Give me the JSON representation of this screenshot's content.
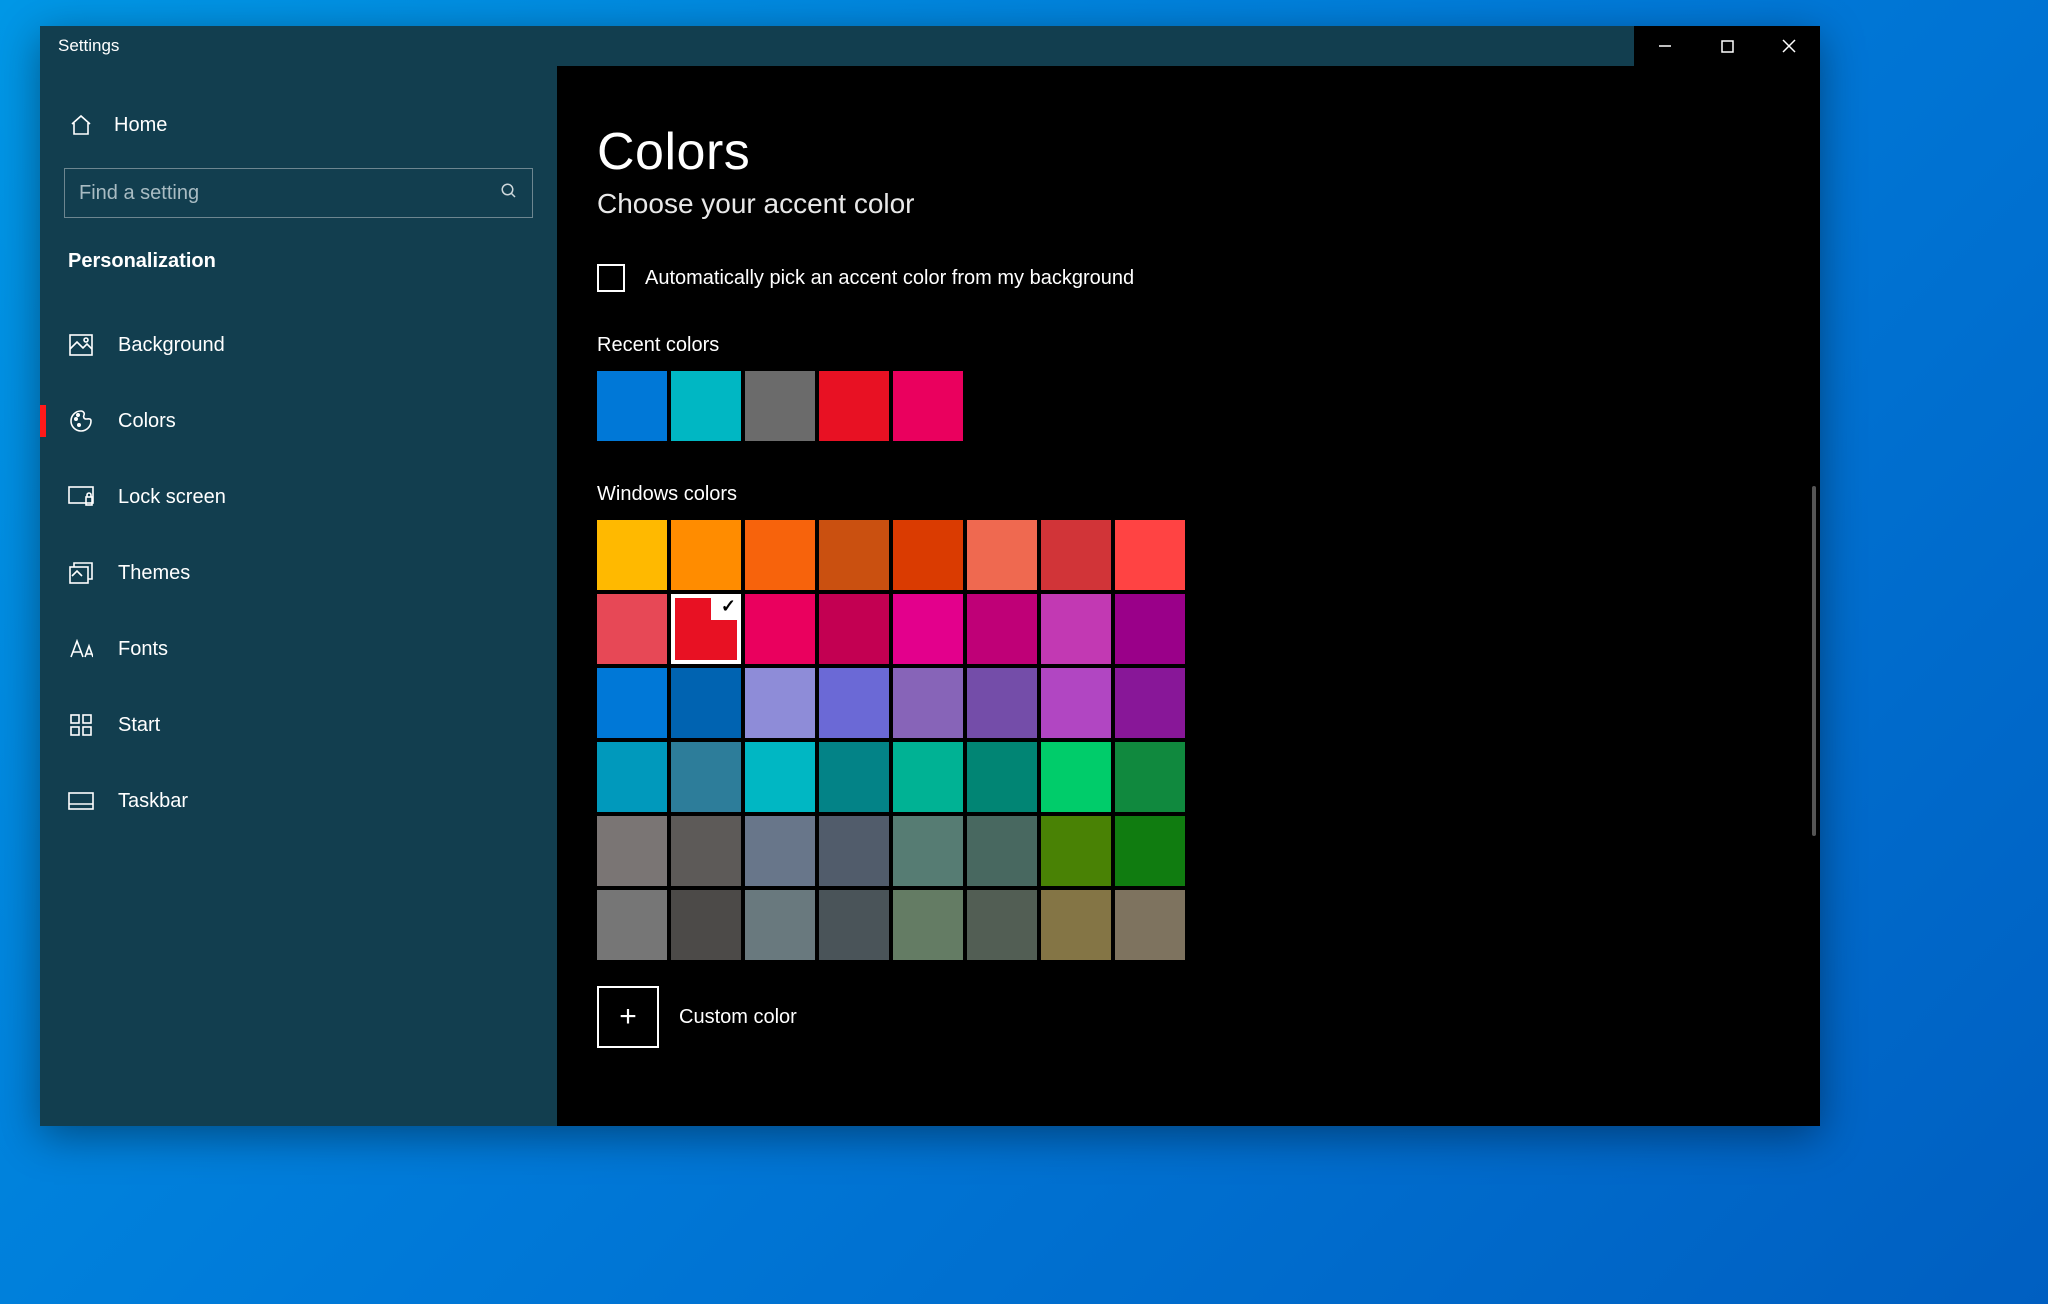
{
  "window": {
    "title": "Settings"
  },
  "sidebar": {
    "home": "Home",
    "search_placeholder": "Find a setting",
    "section": "Personalization",
    "items": [
      {
        "label": "Background",
        "icon": "picture-icon",
        "active": false
      },
      {
        "label": "Colors",
        "icon": "palette-icon",
        "active": true
      },
      {
        "label": "Lock screen",
        "icon": "lockscreen-icon",
        "active": false
      },
      {
        "label": "Themes",
        "icon": "themes-icon",
        "active": false
      },
      {
        "label": "Fonts",
        "icon": "fonts-icon",
        "active": false
      },
      {
        "label": "Start",
        "icon": "start-icon",
        "active": false
      },
      {
        "label": "Taskbar",
        "icon": "taskbar-icon",
        "active": false
      }
    ]
  },
  "main": {
    "title": "Colors",
    "subtitle": "Choose your accent color",
    "auto_pick_label": "Automatically pick an accent color from my background",
    "auto_pick_checked": false,
    "recent_label": "Recent colors",
    "recent_colors": [
      "#0078d7",
      "#00b7c3",
      "#6b6b6b",
      "#e81123",
      "#ea005e"
    ],
    "windows_label": "Windows colors",
    "windows_colors": [
      [
        "#ffb900",
        "#ff8c00",
        "#f7630c",
        "#ca5010",
        "#da3b01",
        "#ef6950",
        "#d13438",
        "#ff4343"
      ],
      [
        "#e74856",
        "#e81123",
        "#ea005e",
        "#c30052",
        "#e3008c",
        "#bf0077",
        "#c239b3",
        "#9a0089"
      ],
      [
        "#0078d7",
        "#0063b1",
        "#8e8cd8",
        "#6b69d6",
        "#8764b8",
        "#744da9",
        "#b146c2",
        "#881798"
      ],
      [
        "#0099bc",
        "#2d7d9a",
        "#00b7c3",
        "#038387",
        "#00b294",
        "#018574",
        "#00cc6a",
        "#10893e"
      ],
      [
        "#7a7574",
        "#5d5a58",
        "#68768a",
        "#515c6b",
        "#567c73",
        "#486860",
        "#498205",
        "#107c10"
      ],
      [
        "#767676",
        "#4c4a48",
        "#69797e",
        "#4a5459",
        "#647c64",
        "#525e54",
        "#847545",
        "#7e735f"
      ]
    ],
    "selected_color": "#e81123",
    "custom_label": "Custom color"
  }
}
